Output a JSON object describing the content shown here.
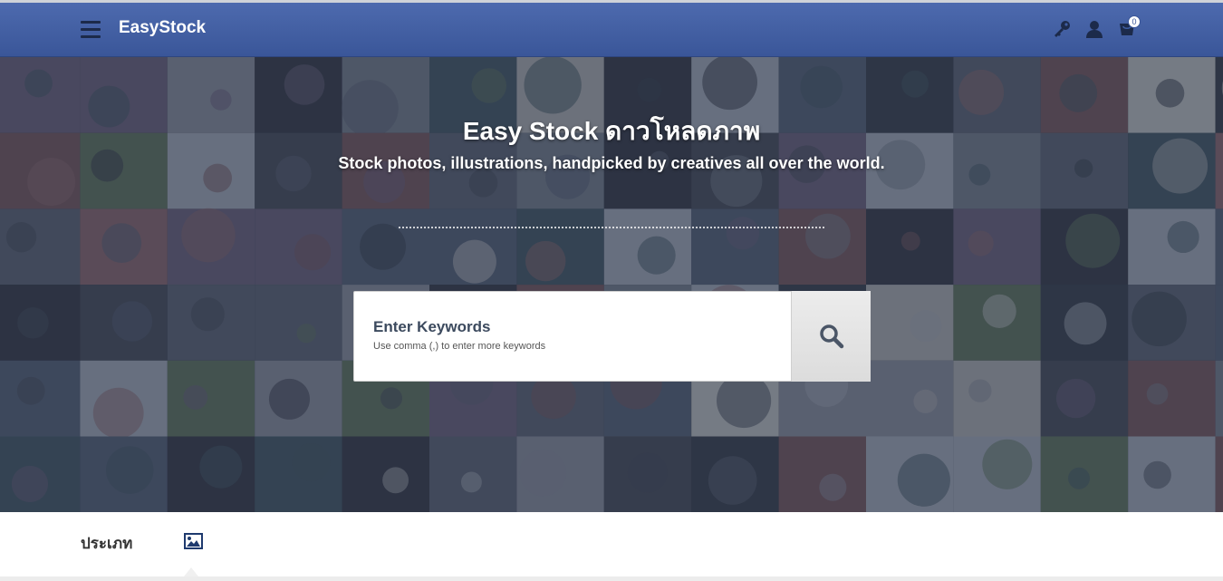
{
  "navbar": {
    "brand": "EasyStock",
    "cart_count": "0",
    "icons": [
      "menu-icon",
      "key-icon",
      "user-icon",
      "cart-icon"
    ]
  },
  "hero": {
    "title": "Easy Stock ดาวโหลดภาพ",
    "subtitle": "Stock photos, illustrations, handpicked by creatives all over the world."
  },
  "search": {
    "label": "Enter Keywords",
    "hint": "Use comma (,) to enter more keywords"
  },
  "category": {
    "label": "ประเภท"
  },
  "colors": {
    "navbar": "#3a5699",
    "hero_overlay": "#2a3243"
  }
}
